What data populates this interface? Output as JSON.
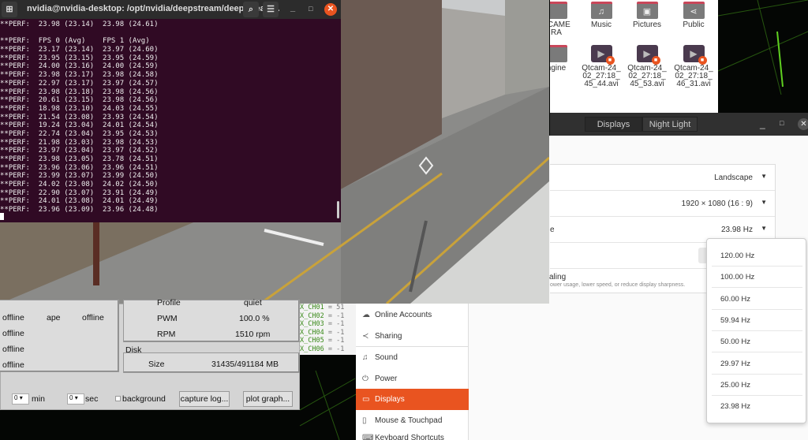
{
  "terminal": {
    "title": "nvidia@nvidia-desktop: /opt/nvidia/deepstream/deepstream...",
    "lines": [
      "**PERF:  23.98 (23.14)  23.98 (24.61)",
      "",
      "**PERF:  FPS 0 (Avg)    FPS 1 (Avg)",
      "**PERF:  23.17 (23.14)  23.97 (24.60)",
      "**PERF:  23.95 (23.15)  23.95 (24.59)",
      "**PERF:  24.00 (23.16)  24.00 (24.59)",
      "**PERF:  23.98 (23.17)  23.98 (24.58)",
      "**PERF:  22.97 (23.17)  23.97 (24.57)",
      "**PERF:  23.98 (23.18)  23.98 (24.56)",
      "**PERF:  20.61 (23.15)  23.98 (24.56)",
      "**PERF:  18.98 (23.10)  24.03 (24.55)",
      "**PERF:  21.54 (23.08)  23.93 (24.54)",
      "**PERF:  19.24 (23.04)  24.01 (24.54)",
      "**PERF:  22.74 (23.04)  23.95 (24.53)",
      "**PERF:  21.98 (23.03)  23.98 (24.53)",
      "**PERF:  23.97 (23.04)  23.97 (24.52)",
      "**PERF:  23.98 (23.05)  23.78 (24.51)",
      "**PERF:  23.96 (23.06)  23.96 (24.51)",
      "**PERF:  23.99 (23.07)  23.99 (24.50)",
      "**PERF:  24.02 (23.08)  24.02 (24.50)",
      "**PERF:  22.90 (23.07)  23.91 (24.49)",
      "**PERF:  24.01 (23.08)  24.01 (24.49)",
      "**PERF:  23.96 (23.09)  23.96 (24.48)"
    ]
  },
  "files": {
    "folders": [
      {
        "label": "ECAME\nRA"
      },
      {
        "label": "Music"
      },
      {
        "label": "Pictures"
      },
      {
        "label": "Public"
      },
      {
        "label": "ngine"
      }
    ],
    "videos": [
      {
        "label": "Qtcam-24_\n02_27:18_\n45_44.avi"
      },
      {
        "label": "Qtcam-24_\n02_27:18_\n45_53.avi"
      },
      {
        "label": "Qtcam-24_\n02_27:18_\n46_31.avi"
      }
    ]
  },
  "settings": {
    "tabs": [
      "Displays",
      "Night Light"
    ],
    "rows": {
      "orientation": "Landscape",
      "resolution": "1920 × 1080 (16 : 9)",
      "refresh_label": "e",
      "refresh": "23.98 Hz",
      "scaling_label": "caling",
      "scaling_desc": "ower usage, lower speed, or reduce display sharpness."
    },
    "refresh_options": [
      "120.00 Hz",
      "100.00 Hz",
      "60.00 Hz",
      "59.94 Hz",
      "50.00 Hz",
      "29.97 Hz",
      "25.00 Hz",
      "23.98 Hz"
    ],
    "sidebar": [
      "Online Accounts",
      "Sharing",
      "Sound",
      "Power",
      "Displays",
      "Mouse & Touchpad",
      "Keyboard Shortcuts"
    ]
  },
  "panel": {
    "status": [
      "offline",
      "ape",
      "offline",
      "offline",
      "offline",
      "offline"
    ],
    "fan": {
      "profile_label": "Profile",
      "profile": "quiet",
      "pwm_label": "PWM",
      "pwm": "100.0 %",
      "rpm_label": "RPM",
      "rpm": "1510 rpm"
    },
    "disk": {
      "title": "Disk",
      "size_label": "Size",
      "size": "31435/491184 MB"
    },
    "min_value": "0",
    "min_label": "min",
    "sec_value": "0",
    "sec_label": "sec",
    "background_label": "background",
    "capture_button": "capture log...",
    "plot_button": "plot graph..."
  },
  "channels": [
    [
      "X_CH01",
      "51"
    ],
    [
      "X_CH02",
      "-1"
    ],
    [
      "X_CH03",
      "-1"
    ],
    [
      "X_CH04",
      "-1"
    ],
    [
      "X_CH05",
      "-1"
    ],
    [
      "X_CH06",
      "-1"
    ]
  ],
  "colors": {
    "accent": "#e95420",
    "terminal_bg": "#300a24"
  }
}
